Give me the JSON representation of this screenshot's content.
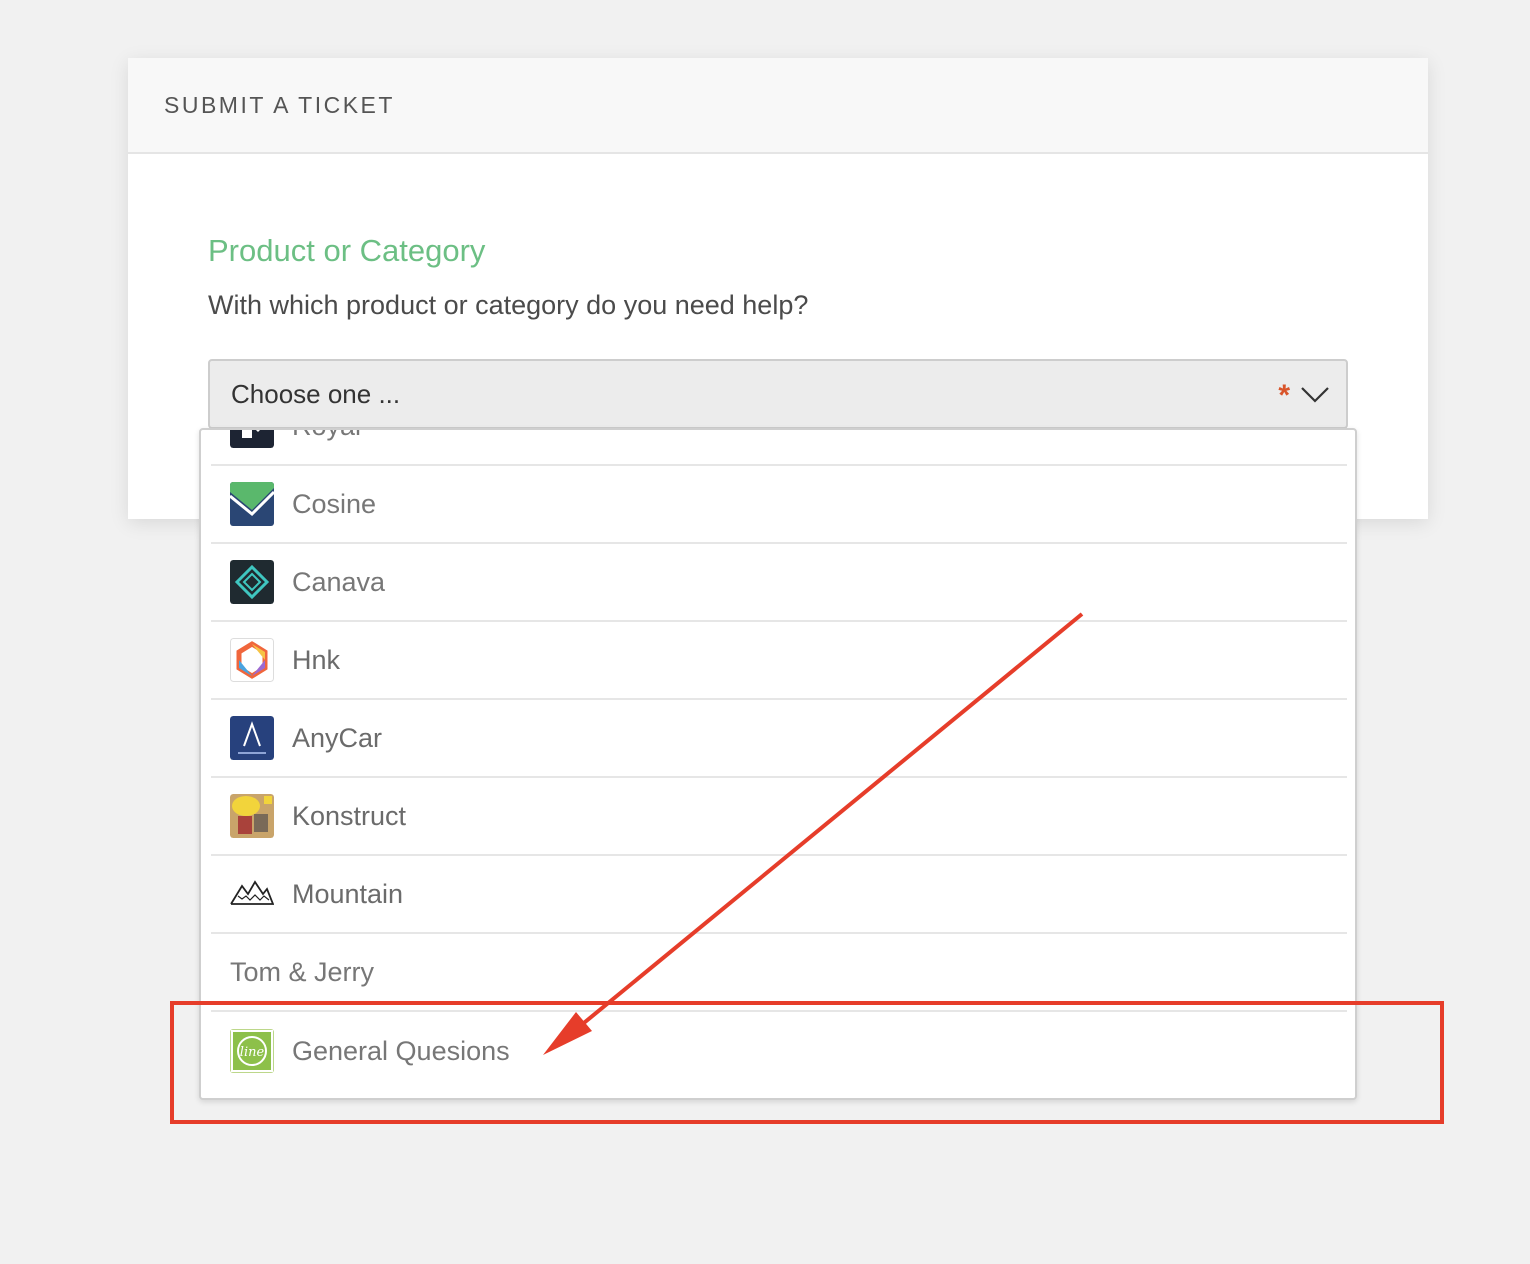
{
  "card": {
    "title": "SUBMIT A TICKET"
  },
  "field": {
    "title": "Product or Category",
    "description": "With which product or category do you need help?",
    "select_value": "Choose one ...",
    "required_mark": "*"
  },
  "dropdown": {
    "items": [
      {
        "label": "Royal",
        "icon": "royal-logo"
      },
      {
        "label": "Cosine",
        "icon": "cosine-logo"
      },
      {
        "label": "Canava",
        "icon": "canava-logo"
      },
      {
        "label": "Hnk",
        "icon": "hnk-logo"
      },
      {
        "label": "AnyCar",
        "icon": "anycar-logo"
      },
      {
        "label": "Konstruct",
        "icon": "konstruct-logo"
      },
      {
        "label": "Mountain",
        "icon": "mountain-logo"
      },
      {
        "label": "Tom & Jerry",
        "icon": ""
      },
      {
        "label": "General Quesions",
        "icon": "line-logo"
      }
    ]
  },
  "annotation": {
    "color": "#e63d2a"
  },
  "colors": {
    "accent_green": "#6cbf84",
    "required_orange": "#d9552b",
    "background": "#f1f1f1"
  }
}
